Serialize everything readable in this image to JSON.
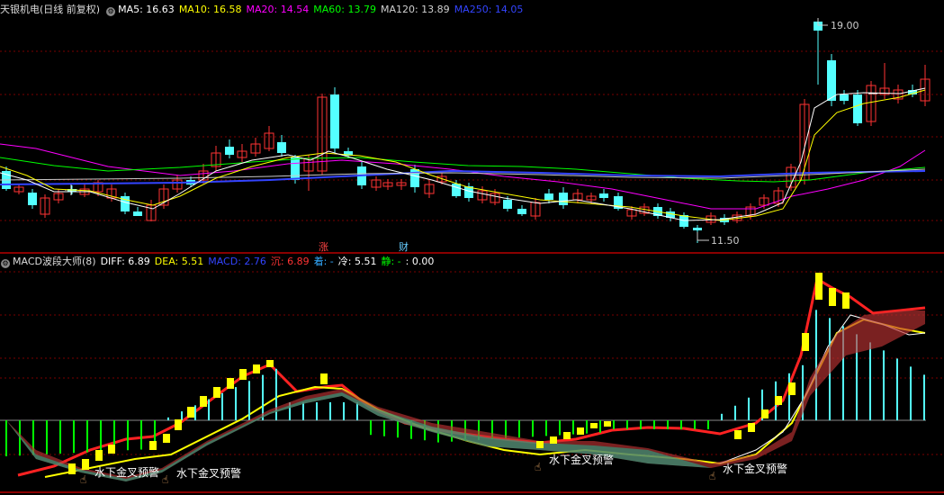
{
  "header_top": {
    "stock": "天银机电(日线 前复权)",
    "ma": [
      {
        "label": "MA5: 16.63",
        "color": "#ffffff"
      },
      {
        "label": "MA10: 16.58",
        "color": "#ffff00"
      },
      {
        "label": "MA20: 14.54",
        "color": "#ff00ff"
      },
      {
        "label": "MA60: 13.79",
        "color": "#00ff00"
      },
      {
        "label": "MA120: 13.89",
        "color": "#d0d0d0"
      },
      {
        "label": "MA250: 14.05",
        "color": "#3344ff"
      }
    ]
  },
  "header_bottom": {
    "indicator": "MACD波段大师(8)",
    "items": [
      {
        "label": "DIFF: 6.89",
        "color": "#ffffff"
      },
      {
        "label": "DEA: 5.51",
        "color": "#ffff00"
      },
      {
        "label": "MACD: 2.76",
        "color": "#3344ff"
      },
      {
        "label": "沉: 6.89",
        "color": "#ff3333"
      },
      {
        "label": "着: -",
        "color": "#33aaff"
      },
      {
        "label": "冷: 5.51",
        "color": "#ffffff"
      },
      {
        "label": "静: -",
        "color": "#00ff00"
      },
      {
        "label": ": 0.00",
        "color": "#ffffff"
      }
    ]
  },
  "price_high_label": "19.00",
  "price_low_label": "11.50",
  "markers": [
    {
      "text": "涨",
      "color": "#ff4444"
    },
    {
      "text": "财",
      "color": "#66ccff"
    }
  ],
  "warnings": {
    "text1": "水下金叉预警",
    "text2": "水下金叉预警",
    "text3": "水下金叉预警",
    "text4": "水下金叉预警"
  },
  "colors": {
    "up": "#ff3333",
    "down": "#54ffff",
    "grid": "#7a0000",
    "diff": "#ffffff",
    "dea": "#ffff00"
  }
}
